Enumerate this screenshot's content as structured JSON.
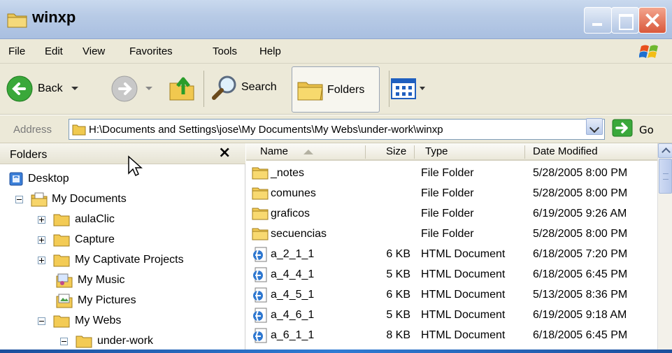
{
  "window": {
    "title": "winxp",
    "colors": {
      "titlebar": "#b8cbe6",
      "close": "#d9583b",
      "chrome": "#ece9d8"
    }
  },
  "menu": [
    "File",
    "Edit",
    "View",
    "Favorites",
    "Tools",
    "Help"
  ],
  "toolbar": {
    "back_label": "Back",
    "search_label": "Search",
    "folders_label": "Folders",
    "icons": [
      "back-arrow-icon",
      "forward-arrow-icon",
      "up-folder-icon",
      "search-magnifier-icon",
      "folders-icon",
      "views-icon"
    ]
  },
  "address": {
    "label": "Address",
    "path": "H:\\Documents and Settings\\jose\\My Documents\\My Webs\\under-work\\winxp",
    "go_label": "Go"
  },
  "folders_pane": {
    "title": "Folders",
    "close_glyph": "×",
    "tree": [
      {
        "label": "Desktop",
        "icon": "desktop-icon",
        "expander": ""
      },
      {
        "label": "My Documents",
        "icon": "my-documents-icon",
        "expander": "minus"
      },
      {
        "label": "aulaClic",
        "icon": "folder-icon",
        "expander": "plus"
      },
      {
        "label": "Capture",
        "icon": "folder-icon",
        "expander": "plus"
      },
      {
        "label": "My Captivate Projects",
        "icon": "folder-icon",
        "expander": "plus"
      },
      {
        "label": "My Music",
        "icon": "my-music-icon",
        "expander": ""
      },
      {
        "label": "My Pictures",
        "icon": "my-pictures-icon",
        "expander": ""
      },
      {
        "label": "My Webs",
        "icon": "folder-icon",
        "expander": "minus"
      },
      {
        "label": "under-work",
        "icon": "folder-icon",
        "expander": "minus"
      }
    ]
  },
  "filelist": {
    "columns": [
      "Name",
      "Size",
      "Type",
      "Date Modified"
    ],
    "sort_column": "Name",
    "rows": [
      {
        "name": "_notes",
        "size": "",
        "type": "File Folder",
        "date": "5/28/2005 8:00 PM",
        "icon": "folder-icon"
      },
      {
        "name": "comunes",
        "size": "",
        "type": "File Folder",
        "date": "5/28/2005 8:00 PM",
        "icon": "folder-icon"
      },
      {
        "name": "graficos",
        "size": "",
        "type": "File Folder",
        "date": "6/19/2005 9:26 AM",
        "icon": "folder-icon"
      },
      {
        "name": "secuencias",
        "size": "",
        "type": "File Folder",
        "date": "5/28/2005 8:00 PM",
        "icon": "folder-icon"
      },
      {
        "name": "a_2_1_1",
        "size": "6 KB",
        "type": "HTML Document",
        "date": "6/18/2005 7:20 PM",
        "icon": "html-document-icon"
      },
      {
        "name": "a_4_4_1",
        "size": "5 KB",
        "type": "HTML Document",
        "date": "6/18/2005 6:45 PM",
        "icon": "html-document-icon"
      },
      {
        "name": "a_4_5_1",
        "size": "6 KB",
        "type": "HTML Document",
        "date": "5/13/2005 8:36 PM",
        "icon": "html-document-icon"
      },
      {
        "name": "a_4_6_1",
        "size": "5 KB",
        "type": "HTML Document",
        "date": "6/19/2005 9:18 AM",
        "icon": "html-document-icon"
      },
      {
        "name": "a_6_1_1",
        "size": "8 KB",
        "type": "HTML Document",
        "date": "6/18/2005 6:45 PM",
        "icon": "html-document-icon"
      }
    ]
  }
}
